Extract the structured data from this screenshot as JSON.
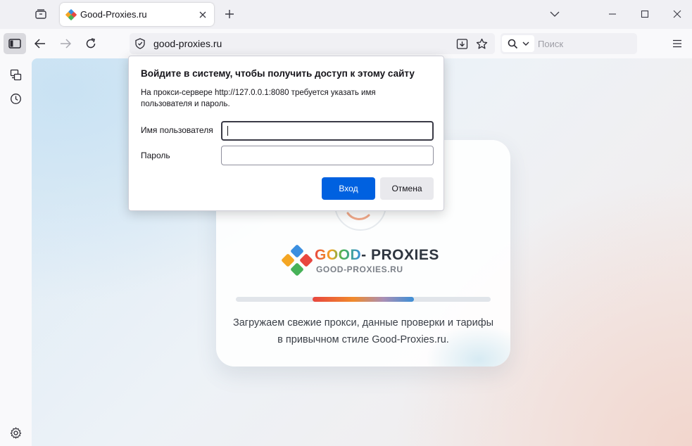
{
  "browser": {
    "tab": {
      "title": "Good-Proxies.ru"
    },
    "url": "good-proxies.ru",
    "search_placeholder": "Поиск"
  },
  "page": {
    "logo": {
      "good": "GOOD",
      "proxies": "- PROXIES",
      "subtitle": "GOOD-PROXIES.RU"
    },
    "progress": 0.4,
    "loading_text": "Загружаем свежие прокси, данные проверки и тарифы в привычном стиле Good-Proxies.ru."
  },
  "auth_dialog": {
    "title": "Войдите в систему, чтобы получить доступ к этому сайту",
    "message": "На прокси-сервере http://127.0.0.1:8080 требуется указать имя пользователя и пароль.",
    "username_label": "Имя пользователя",
    "username_value": "",
    "password_label": "Пароль",
    "password_value": "",
    "login_button": "Вход",
    "cancel_button": "Отмена"
  },
  "colors": {
    "primary_button": "#0061e0",
    "logo_red": "#e8463f",
    "logo_orange": "#f4a623",
    "logo_green": "#47b258",
    "logo_blue": "#3b8fe0"
  }
}
